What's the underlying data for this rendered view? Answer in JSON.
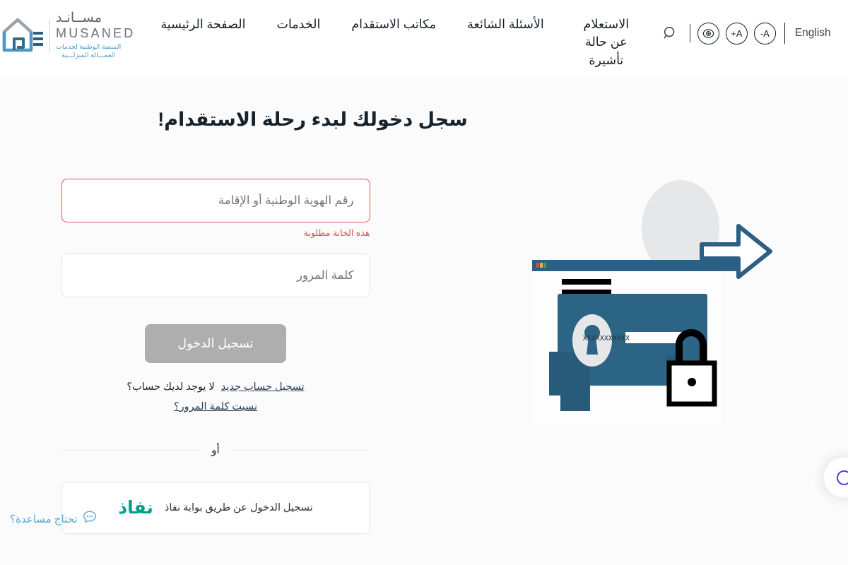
{
  "header": {
    "brand": {
      "name_ar": "مســانـد",
      "name_en": "MUSANED",
      "tagline_line1": "المنصة الوطنية لخدمات",
      "tagline_line2": "العمـــالة المنزلـــية",
      "logo_icon": "musaned-house-logo"
    },
    "nav": [
      {
        "label": "الصفحة الرئيسية",
        "name": "nav-home",
        "wrap": false
      },
      {
        "label": "الخدمات",
        "name": "nav-services",
        "wrap": false
      },
      {
        "label": "مكاتب الاستقدام",
        "name": "nav-recruitment-offices",
        "wrap": false
      },
      {
        "label": "الأسئلة الشائعة",
        "name": "nav-faq",
        "wrap": false
      },
      {
        "label": "الاستعلام عن حالة تأشيرة",
        "name": "nav-visa-status",
        "wrap": true
      }
    ],
    "tools": {
      "search_icon": "search-icon",
      "font_decrease": "A-",
      "font_increase": "A+",
      "contrast_icon": "contrast-eye-icon",
      "language_label": "English"
    }
  },
  "main": {
    "title": "سجل دخولك لبدء رحلة الاستقدام!",
    "form": {
      "id_field": {
        "placeholder": "رقم الهوية الوطنية أو الإقامة",
        "value": "",
        "error": "هذه الخانة مطلوبة"
      },
      "password_field": {
        "placeholder": "كلمة المرور",
        "value": ""
      },
      "login_button": "تسجيل الدخول",
      "no_account_text": "لا يوجد لديك حساب؟",
      "register_link": "تسجيل حساب جديد",
      "forgot_link": "نسيت كلمة المرور؟",
      "or_text": "أو",
      "nafath": {
        "logo_text": "نفاذ",
        "label": "تسجيل الدخول عن طريق بوابة نفاذ",
        "color": "#00a189"
      }
    },
    "illustration": {
      "name": "login-security-illustration",
      "password_mask": "XXXXXXXXXXX"
    }
  },
  "widgets": {
    "help": {
      "label": "تحتاج مساعدة؟",
      "icon": "chat-bubble-icon",
      "color": "#5aa8d8"
    },
    "edge_widget": {
      "icon": "loading-circle-icon",
      "color": "#5b2fe0"
    }
  },
  "colors": {
    "error_red": "#d9544e",
    "brand_blue": "#4f9ac4",
    "nafath_teal": "#00a189",
    "button_disabled": "#aeaeae",
    "text_dark": "#16222c"
  }
}
